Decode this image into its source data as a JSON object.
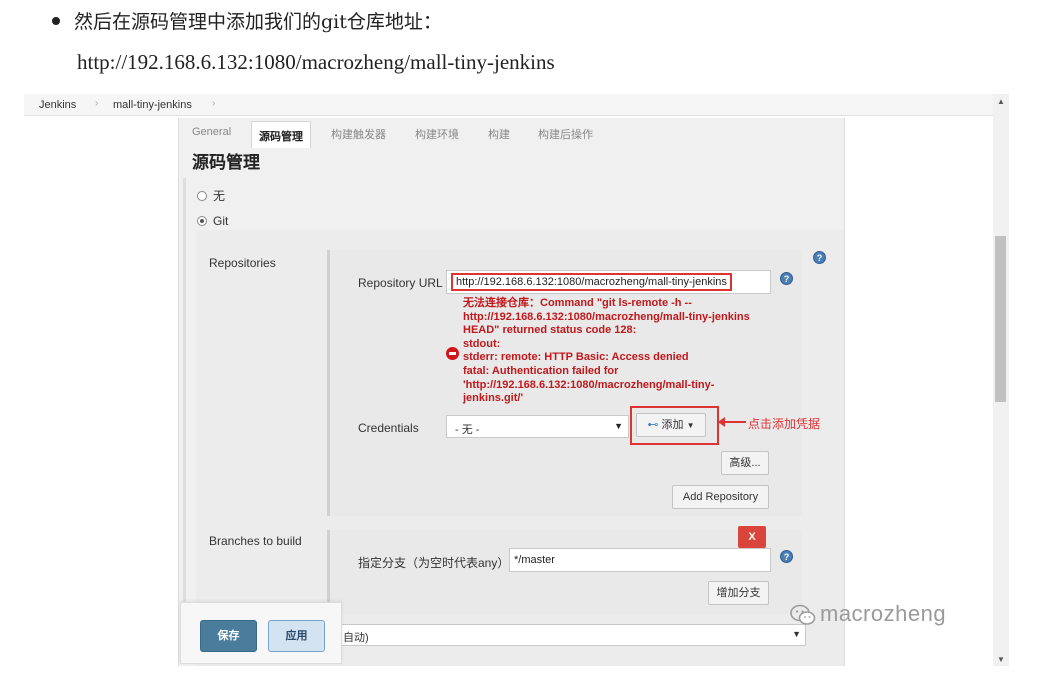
{
  "article": {
    "line1": "然后在源码管理中添加我们的git仓库地址：",
    "line2": "http://192.168.6.132:1080/macrozheng/mall-tiny-jenkins"
  },
  "breadcrumb": {
    "items": [
      "Jenkins",
      "mall-tiny-jenkins"
    ],
    "separator": "›"
  },
  "tabs": [
    {
      "label": "General",
      "active": false
    },
    {
      "label": "源码管理",
      "active": true
    },
    {
      "label": "构建触发器",
      "active": false
    },
    {
      "label": "构建环境",
      "active": false
    },
    {
      "label": "构建",
      "active": false
    },
    {
      "label": "构建后操作",
      "active": false
    }
  ],
  "section_title": "源码管理",
  "scm_options": [
    {
      "label": "无",
      "checked": false
    },
    {
      "label": "Git",
      "checked": true
    }
  ],
  "repositories": {
    "label": "Repositories",
    "url_label": "Repository URL",
    "url_value": "http://192.168.6.132:1080/macrozheng/mall-tiny-jenkins",
    "error_lines": [
      "无法连接仓库：Command \"git ls-remote -h --",
      "http://192.168.6.132:1080/macrozheng/mall-tiny-jenkins",
      "HEAD\" returned status code 128:",
      "stdout:",
      "stderr: remote: HTTP Basic: Access denied",
      "fatal: Authentication failed for",
      "'http://192.168.6.132:1080/macrozheng/mall-tiny-",
      "jenkins.git/'"
    ],
    "credentials_label": "Credentials",
    "credentials_value": "- 无 -",
    "add_button": "添加",
    "annotation": "点击添加凭据",
    "advanced_button": "高级...",
    "add_repository_button": "Add Repository"
  },
  "branches": {
    "label": "Branches to build",
    "delete_button": "X",
    "specifier_label": "指定分支（为空时代表any）",
    "specifier_value": "*/master",
    "add_branch_button": "增加分支"
  },
  "footer": {
    "save": "保存",
    "apply": "应用",
    "browser_select_value": "自动)"
  },
  "watermark": "macrozheng",
  "colors": {
    "error_red": "#c0181b",
    "highlight_red": "#dd3333",
    "save_blue": "#4a7d9b",
    "apply_blue": "#d3e3f2",
    "help_blue": "#4a7db3"
  }
}
